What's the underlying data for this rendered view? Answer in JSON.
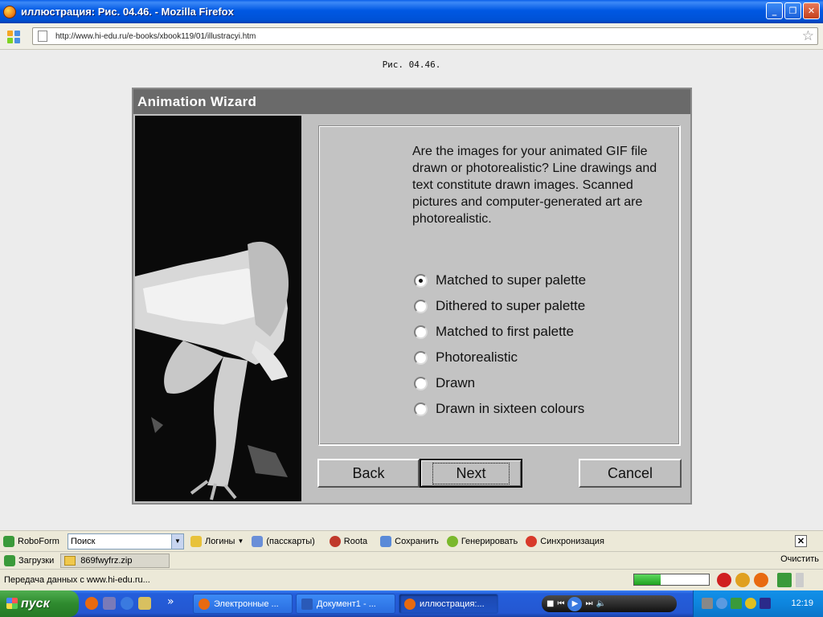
{
  "window": {
    "title": "иллюстрация: Рис. 04.46. - Mozilla Firefox",
    "minimize_glyph": "_",
    "restore_glyph": "❐",
    "close_glyph": "✕"
  },
  "nav": {
    "url": "http://www.hi-edu.ru/e-books/xbook119/01/illustracyi.htm",
    "star_glyph": "☆"
  },
  "page": {
    "caption": "Рис. 04.46."
  },
  "wizard": {
    "title": "Animation Wizard",
    "question": "Are the images for your animated GIF file drawn or photorealistic? Line drawings and text constitute drawn images. Scanned pictures and computer-generated art are photorealistic.",
    "options": [
      {
        "label": "Matched to super palette",
        "checked": true
      },
      {
        "label": "Dithered to super palette",
        "checked": false
      },
      {
        "label": "Matched to first palette",
        "checked": false
      },
      {
        "label": "Photorealistic",
        "checked": false
      },
      {
        "label": "Drawn",
        "checked": false
      },
      {
        "label": "Drawn in sixteen colours",
        "checked": false
      }
    ],
    "back_label": "Back",
    "next_label": "Next",
    "cancel_label": "Cancel"
  },
  "roboform": {
    "brand": "RoboForm",
    "search_placeholder": "Поиск",
    "logins": "Логины",
    "passcards": "(пасскарты)",
    "roota": "Roota",
    "save": "Сохранить",
    "generate": "Генерировать",
    "sync": "Синхронизация",
    "close_glyph": "✕"
  },
  "downloads": {
    "label": "Загрузки",
    "file": "869fwyfrz.zip",
    "clear": "Очистить"
  },
  "status": {
    "text": "Передача данных с www.hi-edu.ru...",
    "progress": 0.35
  },
  "taskbar": {
    "start": "пуск",
    "overflow": "»",
    "tasks": [
      {
        "label": "Электронные ..."
      },
      {
        "label": "Документ1 - ..."
      },
      {
        "label": "иллюстрация:..."
      }
    ],
    "clock": "12:19"
  },
  "colors": {
    "xp_blue": "#0054e3",
    "wizard_gray": "#c0c0c0",
    "wizard_title": "#6a6a6a"
  }
}
